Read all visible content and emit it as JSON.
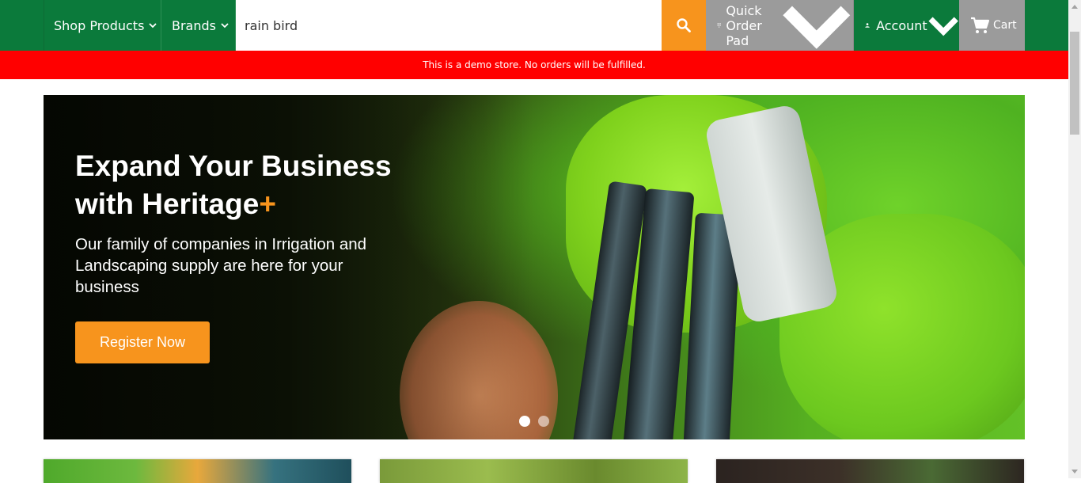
{
  "nav": {
    "shop_products": "Shop Products",
    "brands": "Brands",
    "search_value": "rain bird",
    "quick_order": "Quick Order Pad",
    "account": "Account",
    "cart": "Cart"
  },
  "banner": {
    "text": "This is a demo store. No orders will be fulfilled."
  },
  "hero": {
    "title_line1": "Expand Your Business",
    "title_line2": "with Heritage",
    "title_plus": "+",
    "subtitle": "Our family of companies in Irrigation and Landscaping supply are here for your business",
    "cta": "Register Now",
    "slides": 2,
    "active_slide": 1
  },
  "colors": {
    "brand_green": "#0b7a3b",
    "accent_orange": "#f7941d",
    "banner_red": "#ff0000",
    "nav_gray": "#9b9b9b"
  },
  "icons": {
    "search": "search-icon",
    "quick_order": "keypad-icon",
    "account": "user-icon",
    "cart": "cart-icon",
    "chevron": "chevron-down-icon"
  }
}
